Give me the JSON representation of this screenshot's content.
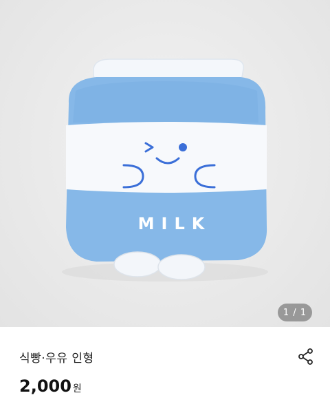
{
  "gallery": {
    "image_alt": "milk carton plush toy",
    "printed_text": "MILK",
    "counter": "1 / 1"
  },
  "product": {
    "title": "식빵·우유 인형",
    "price_value": "2,000",
    "price_unit": "원"
  },
  "icons": {
    "share": "share-icon"
  },
  "colors": {
    "carton_blue": "#86b8e8",
    "carton_white": "#f7f9fc",
    "face_blue": "#3b6fd8"
  }
}
